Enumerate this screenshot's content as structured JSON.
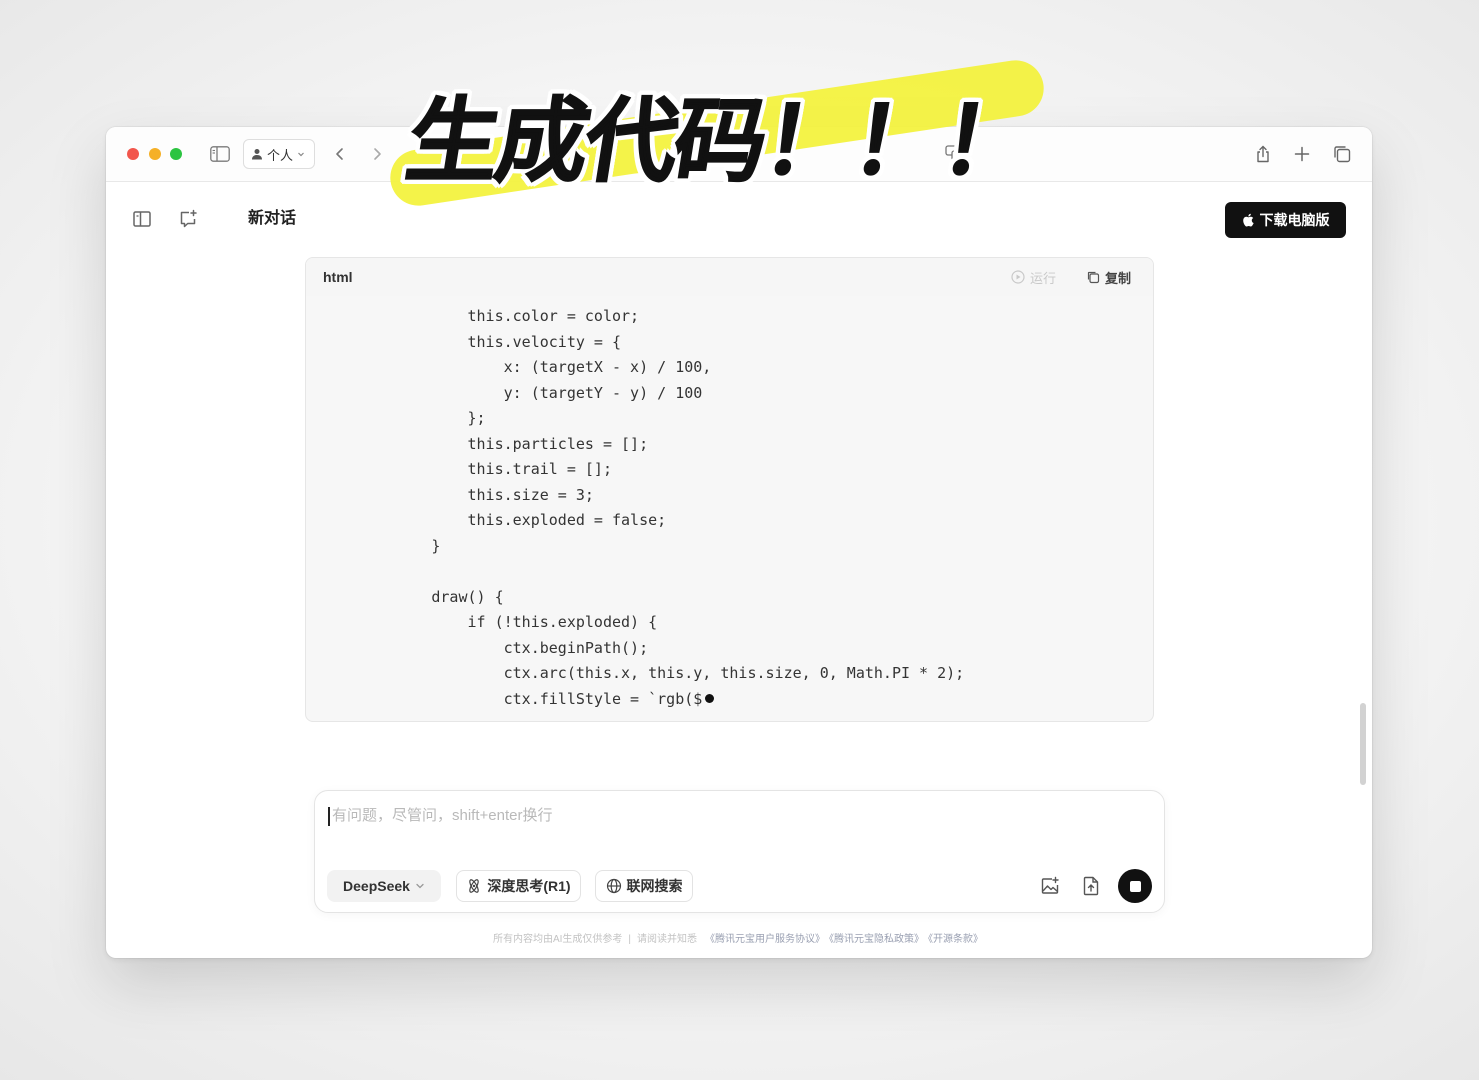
{
  "overlay": {
    "headline": "生成代码！！！"
  },
  "browser": {
    "profile_label": "个人"
  },
  "app": {
    "header": {
      "title": "新对话",
      "download_label": "下载电脑版"
    },
    "code_block": {
      "language": "html",
      "run_label": "运行",
      "copy_label": "复制",
      "lines": [
        "                this.color = color;",
        "                this.velocity = {",
        "                    x: (targetX - x) / 100,",
        "                    y: (targetY - y) / 100",
        "                };",
        "                this.particles = [];",
        "                this.trail = [];",
        "                this.size = 3;",
        "                this.exploded = false;",
        "            }",
        "",
        "            draw() {",
        "                if (!this.exploded) {",
        "                    ctx.beginPath();",
        "                    ctx.arc(this.x, this.y, this.size, 0, Math.PI * 2);",
        "                    ctx.fillStyle = `rgb($"
      ]
    },
    "composer": {
      "placeholder": "有问题，尽管问，shift+enter换行",
      "model_label": "DeepSeek",
      "deep_think_label": "深度思考(R1)",
      "web_search_label": "联网搜索"
    },
    "footer": {
      "disclaimer": "所有内容均由AI生成仅供参考",
      "separator": "|",
      "notice": "请阅读并知悉",
      "links": [
        "《腾讯元宝用户服务协议》",
        "《腾讯元宝隐私政策》",
        "《开源条款》"
      ]
    }
  },
  "icons": {
    "titlebar": [
      "sidebar-icon",
      "person-icon",
      "chevron-down-icon",
      "back-icon",
      "forward-icon",
      "translate-icon",
      "share-icon",
      "plus-icon",
      "tabs-icon"
    ],
    "header": [
      "sidebar-toggle-icon",
      "new-chat-icon",
      "apple-icon"
    ],
    "code_block": [
      "play-circle-icon",
      "copy-icon"
    ],
    "composer": [
      "chevron-down-icon",
      "atom-icon",
      "globe-icon",
      "image-add-icon",
      "upload-file-icon",
      "stop-icon"
    ]
  },
  "colors": {
    "accent": "#111111",
    "highlight": "#f3f23a",
    "traffic-red": "#f2564c",
    "traffic-yellow": "#f5b027",
    "traffic-green": "#2cc441"
  }
}
